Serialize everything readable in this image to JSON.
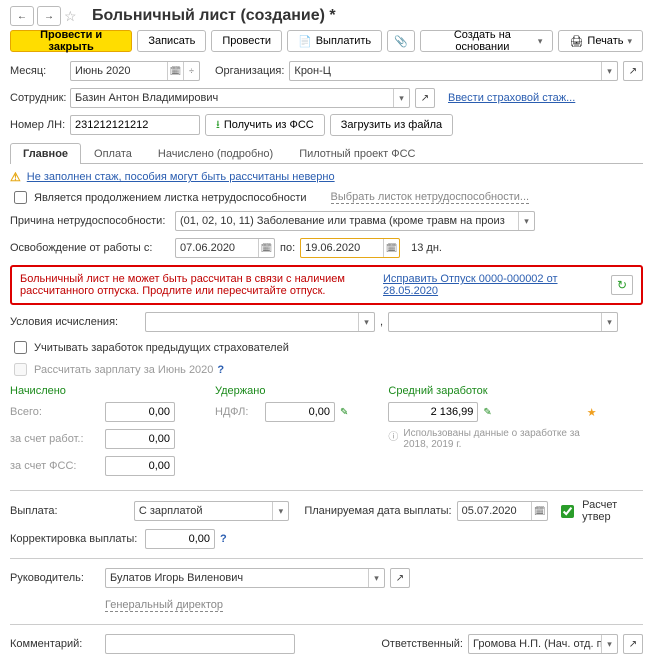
{
  "header": {
    "title": "Больничный лист (создание) *"
  },
  "toolbar": {
    "submit_close": "Провести и закрыть",
    "save": "Записать",
    "submit": "Провести",
    "pay": "Выплатить",
    "create_based": "Создать на основании",
    "print": "Печать"
  },
  "form": {
    "month_label": "Месяц:",
    "month_value": "Июнь 2020",
    "org_label": "Организация:",
    "org_value": "Крон-Ц",
    "employee_label": "Сотрудник:",
    "employee_value": "Базин Антон Владимирович",
    "ins_stage_link": "Ввести страховой стаж...",
    "ln_label": "Номер ЛН:",
    "ln_value": "231212121212",
    "get_fss": "Получить из ФСС",
    "load_file": "Загрузить из файла"
  },
  "tabs": {
    "t1": "Главное",
    "t2": "Оплата",
    "t3": "Начислено (подробно)",
    "t4": "Пилотный проект ФСС"
  },
  "warning": {
    "text": "Не заполнен стаж, пособия могут быть рассчитаны неверно"
  },
  "continuation": {
    "check_label": "Является продолжением листка нетрудоспособности",
    "select_link": "Выбрать листок нетрудоспособности..."
  },
  "reason": {
    "label": "Причина нетрудоспособности:",
    "value": "(01, 02, 10, 11) Заболевание или травма (кроме травм на произ"
  },
  "dates": {
    "label_from": "Освобождение от работы с:",
    "from": "07.06.2020",
    "label_to": "по:",
    "to": "19.06.2020",
    "days": "13 дн."
  },
  "error": {
    "text": "Больничный лист не может быть рассчитан в связи с наличием рассчитанного отпуска. Продлите или пересчитайте отпуск.",
    "link": "Исправить Отпуск 0000-000002 от 28.05.2020"
  },
  "conditions": {
    "label": "Условия исчисления:"
  },
  "checkboxes": {
    "prev_insurers": "Учитывать заработок предыдущих страхователей",
    "calc_salary": "Рассчитать зарплату за Июнь 2020"
  },
  "totals": {
    "accrued_label": "Начислено",
    "total_label": "Всего:",
    "total_val": "0,00",
    "employer_label": "за счет работ.:",
    "employer_val": "0,00",
    "fss_label": "за счет ФСС:",
    "fss_val": "0,00",
    "withheld_label": "Удержано",
    "ndfl_label": "НДФЛ:",
    "ndfl_val": "0,00",
    "avg_label": "Средний заработок",
    "avg_val": "2 136,99",
    "info_text": "Использованы данные о заработке за 2018, 2019 г."
  },
  "payment": {
    "label": "Выплата:",
    "type": "С зарплатой",
    "date_label": "Планируемая дата выплаты:",
    "date": "05.07.2020",
    "confirm": "Расчет утвер"
  },
  "correction": {
    "label": "Корректировка выплаты:",
    "val": "0,00"
  },
  "manager": {
    "label": "Руководитель:",
    "value": "Булатов Игорь Виленович",
    "position": "Генеральный директор"
  },
  "footer": {
    "comment_label": "Комментарий:",
    "resp_label": "Ответственный:",
    "resp_value": "Громова Н.П. (Нач. отд. п"
  },
  "icons": {
    "back": "←",
    "forward": "→",
    "star": "☆",
    "calendar": "🗓",
    "spinner": "÷",
    "dropdown": "▾",
    "open": "↗",
    "clip": "📎",
    "printer": "🖨",
    "warning": "⚠",
    "refresh": "↻",
    "pencil": "✎",
    "info": "ⓘ",
    "star2": "★",
    "check": "✓",
    "cloud": "⭳"
  }
}
